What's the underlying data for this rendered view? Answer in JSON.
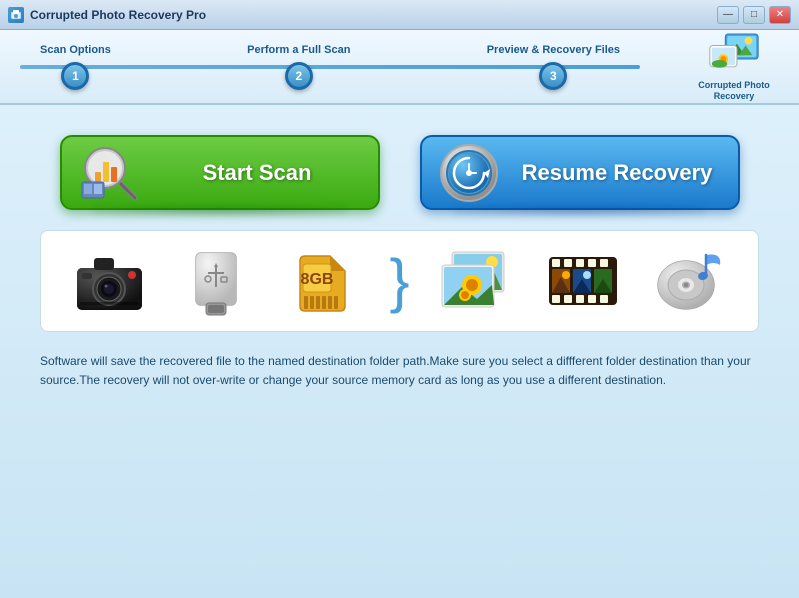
{
  "titlebar": {
    "title": "Corrupted Photo Recovery Pro",
    "minimize": "—",
    "maximize": "□",
    "close": "✕"
  },
  "wizard": {
    "steps": [
      {
        "number": "1",
        "label": "Scan Options"
      },
      {
        "number": "2",
        "label": "Perform a Full Scan"
      },
      {
        "number": "3",
        "label": "Preview & Recovery Files"
      }
    ],
    "logo_line1": "Corrupted Photo",
    "logo_line2": "Recovery"
  },
  "buttons": {
    "scan_label": "Start Scan",
    "resume_label": "Resume Recovery"
  },
  "info": {
    "text": "Software will save the recovered file to the named destination folder path.Make sure you select a diffferent folder destination than your source.The recovery will not over-write or change your source memory card as long as you use a different destination."
  }
}
